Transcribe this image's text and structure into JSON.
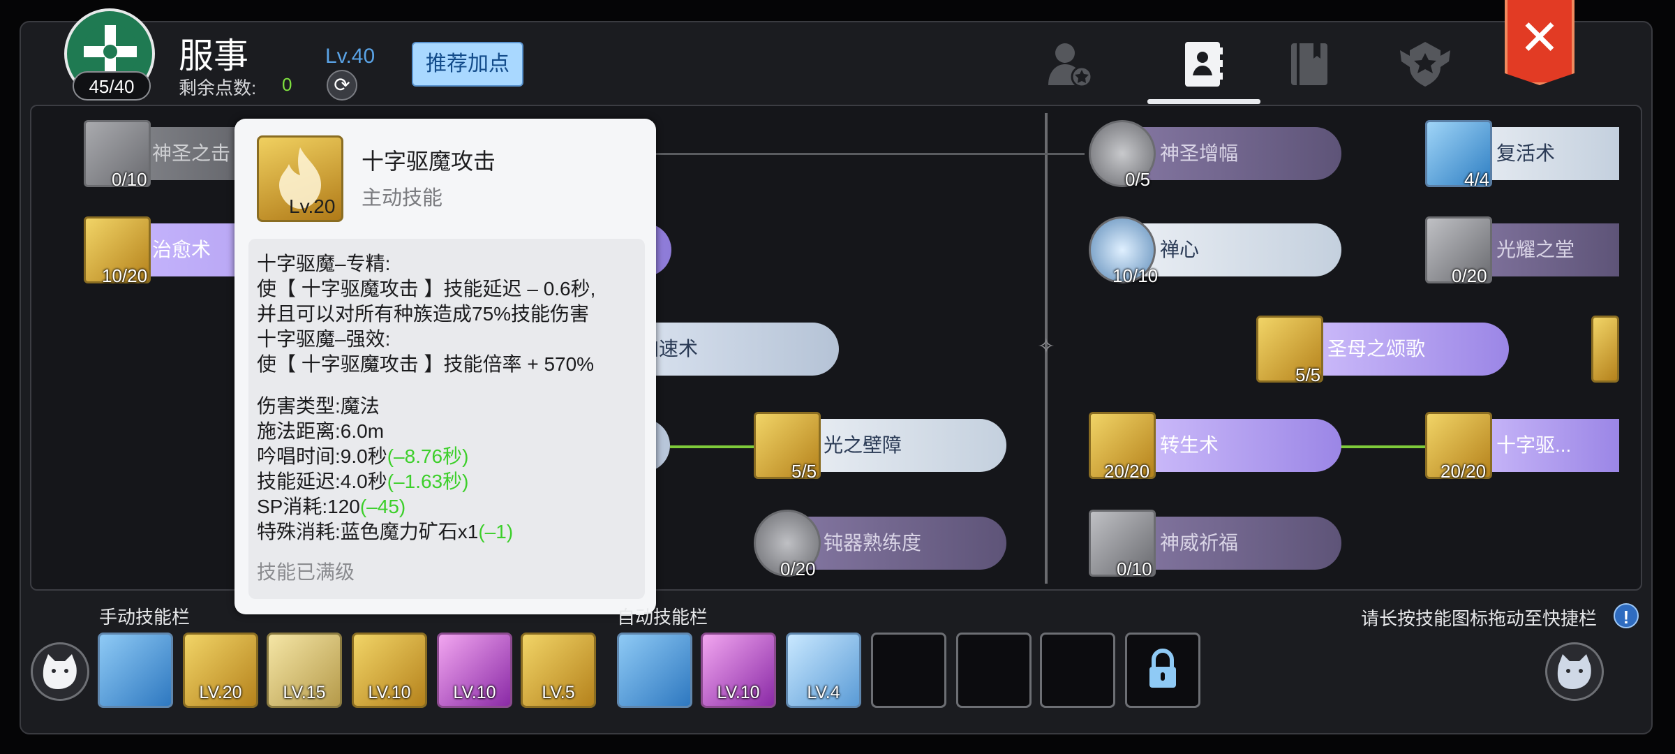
{
  "header": {
    "emblem_count": "45/40",
    "job_name": "服事",
    "remaining_label": "剩余点数:",
    "remaining_value": "0",
    "level": "Lv.40",
    "recommend_button": "推荐加点",
    "tabs": [
      "character-tab",
      "skill-tab",
      "book-tab",
      "emblem-tab"
    ],
    "active_tab": "skill-tab",
    "close_label": "✕"
  },
  "skills_left": [
    {
      "name": "神圣之击",
      "level": "0/10"
    },
    {
      "name": "治愈术",
      "level": "10/20"
    },
    {
      "name": "加速术",
      "level": ""
    },
    {
      "name": "光之壁障",
      "level": "5/5"
    },
    {
      "name": "钝器熟练度",
      "level": "0/20"
    }
  ],
  "skills_right": [
    {
      "name": "神圣增幅",
      "level": "0/5"
    },
    {
      "name": "复活术",
      "level": "4/4"
    },
    {
      "name": "禅心",
      "level": "10/10"
    },
    {
      "name": "光耀之堂",
      "level": "0/20"
    },
    {
      "name": "圣母之颂歌",
      "level": "5/5"
    },
    {
      "name": "转生术",
      "level": "20/20"
    },
    {
      "name": "十字驱...",
      "level": "20/20"
    },
    {
      "name": "神威祈福",
      "level": "0/10"
    }
  ],
  "tooltip": {
    "skill_name": "十字驱魔攻击",
    "skill_type": "主动技能",
    "icon_level": "Lv.20",
    "desc1": "十字驱魔–专精:",
    "desc2": "使【 十字驱魔攻击 】技能延迟 – 0.6秒,",
    "desc3": "并且可以对所有种族造成75%技能伤害",
    "desc4": "十字驱魔–强效:",
    "desc5": "使【 十字驱魔攻击 】技能倍率 + 570%",
    "damage_type": "伤害类型:魔法",
    "cast_range": "施法距离:6.0m",
    "chant_time": "吟唱时间:9.0秒",
    "chant_bonus": "(–8.76秒)",
    "delay": "技能延迟:4.0秒",
    "delay_bonus": "(–1.63秒)",
    "sp_cost": "SP消耗:120",
    "sp_bonus": "(–45)",
    "special_cost": "特殊消耗:蓝色魔力矿石x1",
    "special_bonus": "(–1)",
    "max_text": "技能已满级"
  },
  "bars": {
    "manual_label": "手动技能栏",
    "auto_label": "自动技能栏",
    "hint": "请长按技能图标拖动至快捷栏",
    "hint_icon": "!",
    "manual_slots": [
      "",
      "LV.20",
      "LV.15",
      "LV.10",
      "LV.10",
      "LV.5"
    ],
    "auto_slots": [
      "",
      "LV.10",
      "LV.4"
    ]
  }
}
